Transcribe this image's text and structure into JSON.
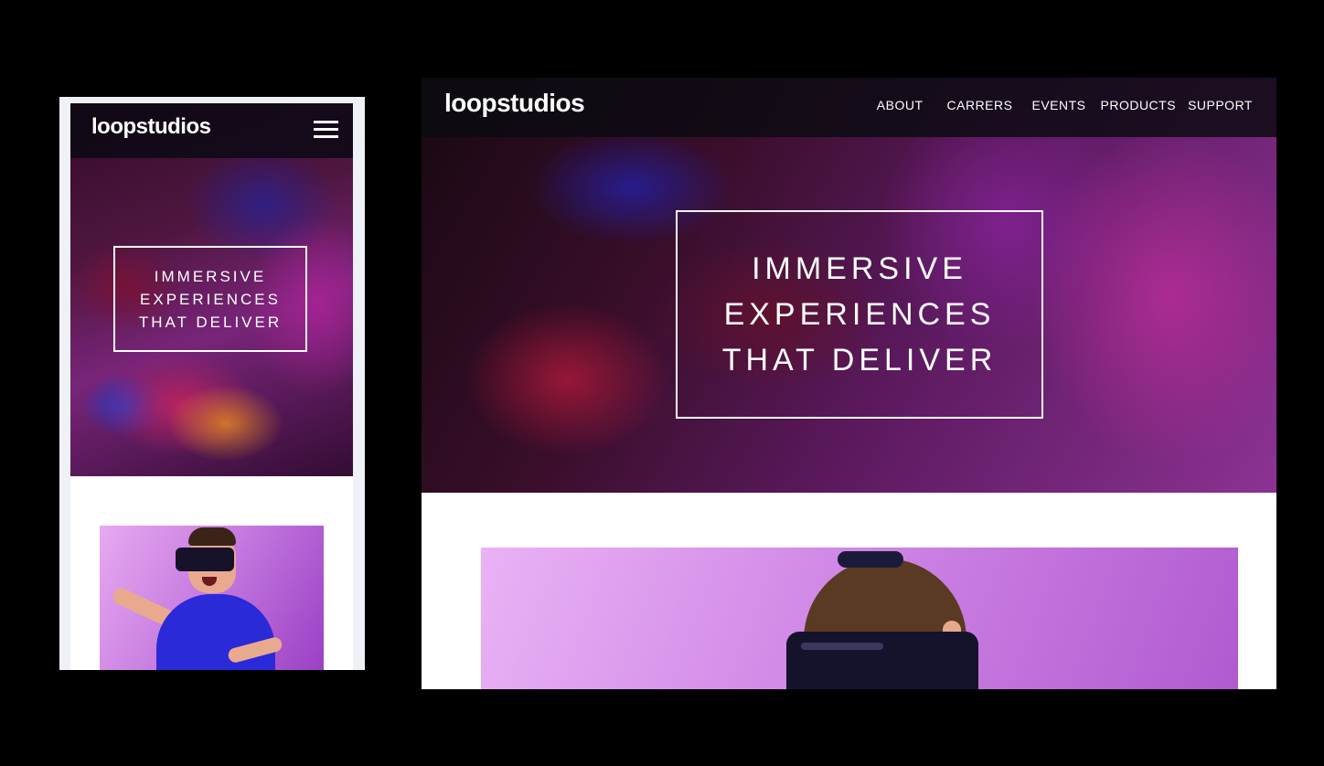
{
  "brand": {
    "name": "loopstudios"
  },
  "mobile": {
    "hero_heading": "IMMERSIVE EXPERIENCES THAT DELIVER",
    "menu_icon": "hamburger-menu-icon"
  },
  "desktop": {
    "nav": {
      "items": [
        {
          "label": "ABOUT"
        },
        {
          "label": "CARRERS"
        },
        {
          "label": "EVENTS"
        },
        {
          "label": "PRODUCTS"
        },
        {
          "label": "SUPPORT"
        }
      ]
    },
    "hero_heading": "IMMERSIVE EXPERIENCES THAT DELIVER"
  },
  "colors": {
    "background": "#000000",
    "nav_bg": "#0c0a12",
    "accent_purple": "#a03aa8",
    "photo_pink": "#d088e6",
    "text": "#ffffff"
  }
}
